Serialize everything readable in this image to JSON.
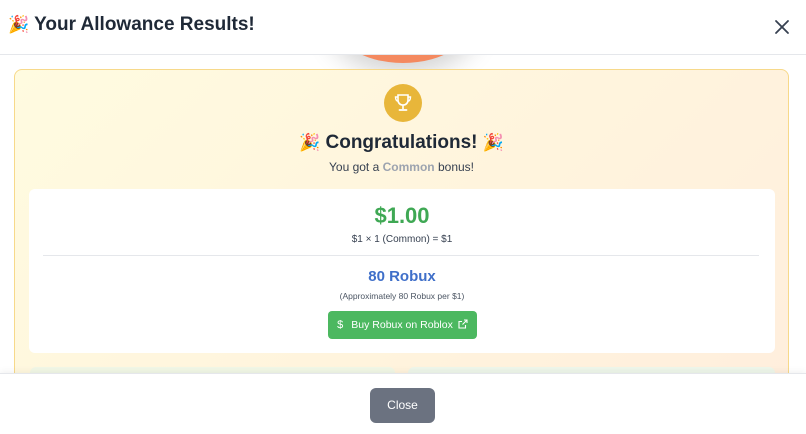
{
  "header": {
    "title_emoji": "🎉",
    "title": "Your Allowance Results!",
    "close_icon": "close-icon"
  },
  "result": {
    "trophy_icon": "trophy-icon",
    "congrats_emoji_left": "🎉",
    "congrats": "Congratulations!",
    "congrats_emoji_right": "🎉",
    "subtitle_prefix": "You got a",
    "rarity": "Common",
    "subtitle_suffix": "bonus!",
    "amount": "$1.00",
    "formula": "$1 × 1 (Common) = $1",
    "robux": "80 Robux",
    "approx": "(Approximately 80 Robux per $1)",
    "buy_icon": "dollar-icon",
    "buy_label": "Buy Robux on Roblox",
    "external_icon": "external-link-icon"
  },
  "footer": {
    "close_label": "Close"
  },
  "colors": {
    "amount": "#3fa854",
    "robux": "#3f6fc9",
    "trophy": "#e8b63a",
    "buy_button": "#4cb860",
    "close_button": "#6b7280",
    "rarity_common": "#9ca3af"
  }
}
